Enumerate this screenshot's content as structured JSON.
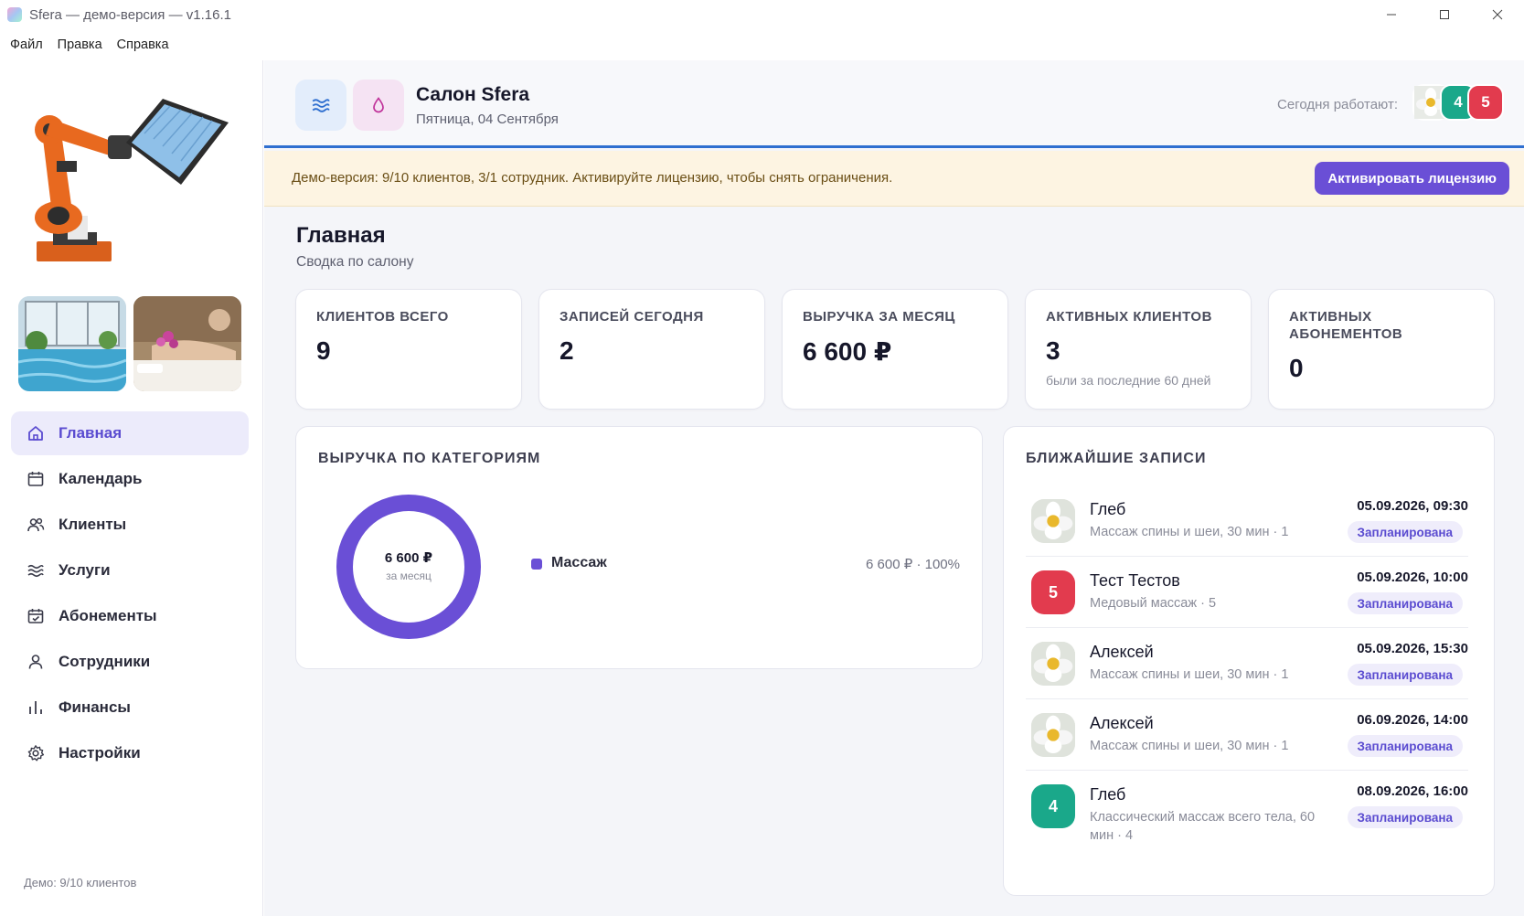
{
  "window": {
    "title": "Sfera — демо-версия — v1.16.1"
  },
  "menu": {
    "items": [
      "Файл",
      "Правка",
      "Справка"
    ]
  },
  "sidebar": {
    "items": [
      {
        "label": "Главная",
        "icon": "home-icon",
        "active": true
      },
      {
        "label": "Календарь",
        "icon": "calendar-icon"
      },
      {
        "label": "Клиенты",
        "icon": "users-icon"
      },
      {
        "label": "Услуги",
        "icon": "waves-icon"
      },
      {
        "label": "Абонементы",
        "icon": "calendar-check-icon"
      },
      {
        "label": "Сотрудники",
        "icon": "user-icon"
      },
      {
        "label": "Финансы",
        "icon": "bar-chart-icon"
      },
      {
        "label": "Настройки",
        "icon": "gear-icon"
      }
    ],
    "footer": "Демо: 9/10 клиентов"
  },
  "header": {
    "salon_name": "Салон Sfera",
    "date": "Пятница, 04 Сентября",
    "today_label": "Сегодня работают:",
    "staff_avatars": [
      {
        "kind": "photo",
        "text": ""
      },
      {
        "kind": "initial",
        "text": "4",
        "color": "#1aa88a"
      },
      {
        "kind": "initial",
        "text": "5",
        "color": "#e23b4e"
      }
    ]
  },
  "banner": {
    "text": "Демо-версия: 9/10 клиентов, 3/1 сотрудник. Активируйте лицензию, чтобы снять ограничения.",
    "button": "Активировать лицензию"
  },
  "page": {
    "title": "Главная",
    "subtitle": "Сводка по салону"
  },
  "kpis": [
    {
      "label": "Клиентов всего",
      "value": "9",
      "sub": ""
    },
    {
      "label": "Записей сегодня",
      "value": "2",
      "sub": ""
    },
    {
      "label": "Выручка за месяц",
      "value": "6 600 ₽",
      "sub": ""
    },
    {
      "label": "Активных клиентов",
      "value": "3",
      "sub": "были за последние 60 дней"
    },
    {
      "label": "Активных абонементов",
      "value": "0",
      "sub": ""
    }
  ],
  "revenue": {
    "title": "Выручка по категориям",
    "total": "6 600 ₽",
    "total_sub": "за месяц",
    "items": [
      {
        "name": "Массаж",
        "value": "6 600 ₽ · 100%",
        "share": 100,
        "color": "#6a4fd6"
      }
    ]
  },
  "upcoming": {
    "title": "Ближайшие записи",
    "items": [
      {
        "name": "Глеб",
        "service": "Массаж спины и шеи, 30 мин · 1",
        "datetime": "05.09.2026, 09:30",
        "status": "Запланирована",
        "avatar": {
          "kind": "photo",
          "text": ""
        }
      },
      {
        "name": "Тест Тестов",
        "service": "Медовый массаж · 5",
        "datetime": "05.09.2026, 10:00",
        "status": "Запланирована",
        "avatar": {
          "kind": "initial",
          "text": "5",
          "color": "#e23b4e"
        }
      },
      {
        "name": "Алексей",
        "service": "Массаж спины и шеи, 30 мин · 1",
        "datetime": "05.09.2026, 15:30",
        "status": "Запланирована",
        "avatar": {
          "kind": "photo",
          "text": ""
        }
      },
      {
        "name": "Алексей",
        "service": "Массаж спины и шеи, 30 мин · 1",
        "datetime": "06.09.2026, 14:00",
        "status": "Запланирована",
        "avatar": {
          "kind": "photo",
          "text": ""
        }
      },
      {
        "name": "Глеб",
        "service": "Классический массаж всего тела, 60 мин · 4",
        "datetime": "08.09.2026, 16:00",
        "status": "Запланирована",
        "avatar": {
          "kind": "initial",
          "text": "4",
          "color": "#1aa88a"
        }
      }
    ]
  },
  "colors": {
    "accent": "#6a4fd6",
    "header_line": "#2f6fd0",
    "banner_bg": "#fdf4e2"
  }
}
